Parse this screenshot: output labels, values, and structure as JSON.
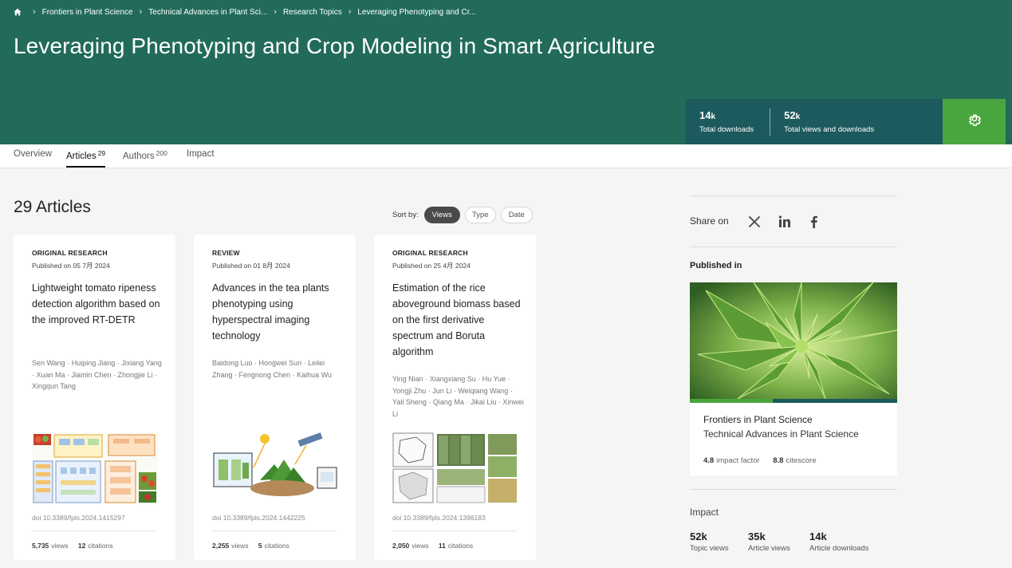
{
  "breadcrumb": {
    "items": [
      "Frontiers in Plant Science",
      "Technical Advances in Plant Sci...",
      "Research Topics",
      "Leveraging Phenotyping and Cr..."
    ]
  },
  "header": {
    "title": "Leveraging Phenotyping and Crop Modeling in Smart Agriculture",
    "stats": [
      {
        "value": "14",
        "unit": "k",
        "label": "Total downloads"
      },
      {
        "value": "52",
        "unit": "k",
        "label": "Total views and downloads"
      }
    ],
    "accent": "#226b5b",
    "stats_bg": "#1d5a5e",
    "settings_bg": "#4aa63e"
  },
  "tabs": [
    {
      "label": "Overview",
      "count": ""
    },
    {
      "label": "Articles",
      "count": "29"
    },
    {
      "label": "Authors",
      "count": "200"
    },
    {
      "label": "Impact",
      "count": ""
    }
  ],
  "main": {
    "heading": "29 Articles",
    "sort": {
      "label": "Sort by:",
      "options": [
        "Views",
        "Type",
        "Date"
      ],
      "selected": "Views"
    }
  },
  "articles": [
    {
      "type": "ORIGINAL RESEARCH",
      "published": "Published on 05 7月 2024",
      "title": "Lightweight tomato ripeness detection algorithm based on the improved RT-DETR",
      "authors": "Sen Wang · Huiping Jiang · Jixiang Yang · Xuan Ma · Jiamin Chen · Zhongjie Li · Xingqun Tang",
      "doi": "doi 10.3389/fpls.2024.1415297",
      "views": "5,735",
      "views_label": "views",
      "citations": "12",
      "citations_label": "citations"
    },
    {
      "type": "REVIEW",
      "published": "Published on 01 8月 2024",
      "title": "Advances in the tea plants phenotyping using hyperspectral imaging technology",
      "authors": "Baidong Luo · Hongwei Sun · Leilei Zhang · Fengnong Chen · Kaihua Wu",
      "doi": "doi 10.3389/fpls.2024.1442225",
      "views": "2,255",
      "views_label": "views",
      "citations": "5",
      "citations_label": "citations"
    },
    {
      "type": "ORIGINAL RESEARCH",
      "published": "Published on 25 4月 2024",
      "title": "Estimation of the rice aboveground biomass based on the first derivative spectrum and Boruta algorithm",
      "authors": "Ying Nian · Xiangxiang Su · Hu Yue · Yongji Zhu · Jun Li · Weiqiang Wang · Yali Sheng · Qiang Ma · Jikai Liu · Xinwei Li",
      "doi": "doi 10.3389/fpls.2024.1396183",
      "views": "2,050",
      "views_label": "views",
      "citations": "11",
      "citations_label": "citations"
    }
  ],
  "sidebar": {
    "share_label": "Share on",
    "share_icons": [
      "x-icon",
      "linkedin-icon",
      "facebook-icon"
    ],
    "published_label": "Published in",
    "journal": {
      "name": "Frontiers in Plant Science",
      "section": "Technical Advances in Plant Science",
      "impact_factor": "4.8",
      "impact_factor_label": "impact factor",
      "citescore": "8.8",
      "citescore_label": "citescore",
      "bar_fill_fraction": 0.4
    },
    "impact": {
      "label": "Impact",
      "stats": [
        {
          "value": "52k",
          "label": "Topic views"
        },
        {
          "value": "35k",
          "label": "Article views"
        },
        {
          "value": "14k",
          "label": "Article downloads"
        }
      ]
    }
  }
}
